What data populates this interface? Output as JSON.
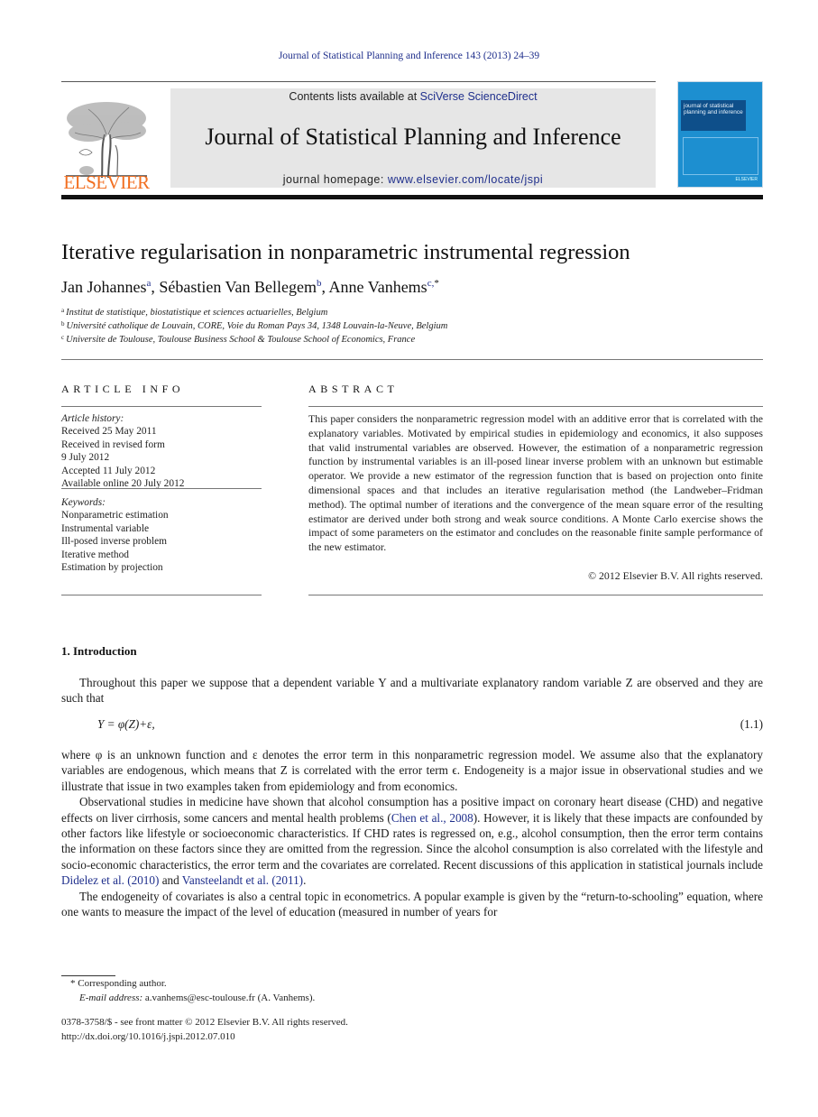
{
  "running_head": "Journal of Statistical Planning and Inference 143 (2013) 24–39",
  "banner": {
    "publisher_logo_text": "ELSEVIER",
    "contents_prefix": "Contents lists available at ",
    "contents_link": "SciVerse ScienceDirect",
    "journal_title": "Journal of Statistical Planning and Inference",
    "homepage_prefix": "journal homepage: ",
    "homepage_link": "www.elsevier.com/locate/jspi",
    "cover_title": "journal of statistical planning and inference",
    "cover_publisher": "ELSEVIER"
  },
  "title": "Iterative regularisation in nonparametric instrumental regression",
  "authors": [
    {
      "name": "Jan Johannes",
      "sup": "a"
    },
    {
      "name": "Sébastien Van Bellegem",
      "sup": "b"
    },
    {
      "name": "Anne Vanhems",
      "sup": "c,",
      "star": "*"
    }
  ],
  "affiliations": [
    {
      "key": "a",
      "text": "Institut de statistique, biostatistique et sciences actuarielles, Belgium"
    },
    {
      "key": "b",
      "text": "Université catholique de Louvain, CORE, Voie du Roman Pays 34, 1348 Louvain-la-Neuve, Belgium"
    },
    {
      "key": "c",
      "text": "Universite de Toulouse, Toulouse Business School & Toulouse School of Economics, France"
    }
  ],
  "article_info": {
    "heading": "ARTICLE INFO",
    "history_label": "Article history:",
    "history": [
      "Received 25 May 2011",
      "Received in revised form",
      "9 July 2012",
      "Accepted 11 July 2012",
      "Available online 20 July 2012"
    ],
    "keywords_label": "Keywords:",
    "keywords": [
      "Nonparametric estimation",
      "Instrumental variable",
      "Ill-posed inverse problem",
      "Iterative method",
      "Estimation by projection"
    ]
  },
  "abstract": {
    "heading": "ABSTRACT",
    "text": "This paper considers the nonparametric regression model with an additive error that is correlated with the explanatory variables. Motivated by empirical studies in epidemiology and economics, it also supposes that valid instrumental variables are observed. However, the estimation of a nonparametric regression function by instrumental variables is an ill-posed linear inverse problem with an unknown but estimable operator. We provide a new estimator of the regression function that is based on projection onto finite dimensional spaces and that includes an iterative regularisation method (the Landweber–Fridman method). The optimal number of iterations and the convergence of the mean square error of the resulting estimator are derived under both strong and weak source conditions. A Monte Carlo exercise shows the impact of some parameters on the estimator and concludes on the reasonable finite sample performance of the new estimator.",
    "copyright": "© 2012 Elsevier B.V. All rights reserved."
  },
  "introduction": {
    "heading": "1.  Introduction",
    "para1": "Throughout this paper we suppose that a dependent variable Y and a multivariate explanatory random variable Z are observed and they are such that",
    "equation": "Y = φ(Z)+ε,",
    "equation_number": "(1.1)",
    "para2": "where φ is an unknown function and ε denotes the error term in this nonparametric regression model. We assume also that the explanatory variables are endogenous, which means that Z is correlated with the error term ϵ. Endogeneity is a major issue in observational studies and we illustrate that issue in two examples taken from epidemiology and from economics.",
    "para3_a": "Observational studies in medicine have shown that alcohol consumption has a positive impact on coronary heart disease (CHD) and negative effects on liver cirrhosis, some cancers and mental health problems (",
    "para3_cite1": "Chen et al., 2008",
    "para3_b": "). However, it is likely that these impacts are confounded by other factors like lifestyle or socioeconomic characteristics. If CHD rates is regressed on, e.g., alcohol consumption, then the error term contains the information on these factors since they are omitted from the regression. Since the alcohol consumption is also correlated with the lifestyle and socio-economic characteristics, the error term and the covariates are correlated. Recent discussions of this application in statistical journals include ",
    "para3_cite2": "Didelez et al. (2010)",
    "para3_c": " and ",
    "para3_cite3": "Vansteelandt et al. (2011)",
    "para3_d": ".",
    "para4": "The endogeneity of covariates is also a central topic in econometrics. A popular example is given by the “return-to-schooling” equation, where one wants to measure the impact of the level of education (measured in number of years for"
  },
  "footnotes": {
    "corresponding": "* Corresponding author.",
    "email_label": "E-mail address:",
    "email": " a.vanhems@esc-toulouse.fr (A. Vanhems).",
    "issn": "0378-3758/$ - see front matter © 2012 Elsevier B.V. All rights reserved.",
    "doi": "http://dx.doi.org/10.1016/j.jspi.2012.07.010"
  },
  "colors": {
    "link": "#1f2f8c",
    "elsevier_orange": "#f26f21",
    "banner_gray": "#e6e6e6",
    "cover_blue": "#1d8fd0"
  }
}
